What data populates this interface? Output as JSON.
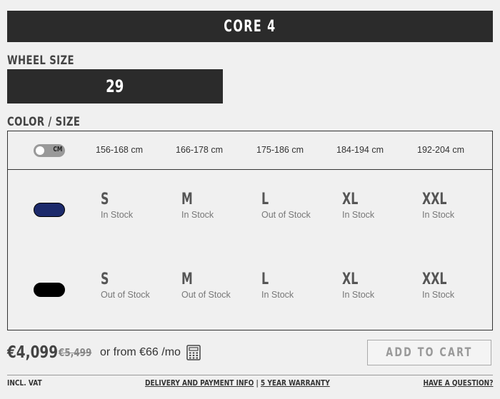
{
  "model": {
    "title": "CORE 4"
  },
  "wheel": {
    "label": "WHEEL SIZE",
    "value": "29"
  },
  "color_size": {
    "label": "COLOR / SIZE",
    "unit_toggle": "CM",
    "heights": [
      "156-168 cm",
      "166-178 cm",
      "175-186 cm",
      "184-194 cm",
      "192-204 cm"
    ],
    "rows": [
      {
        "color": "#1c2a6b",
        "sizes": [
          {
            "size": "S",
            "status": "In Stock"
          },
          {
            "size": "M",
            "status": "In Stock"
          },
          {
            "size": "L",
            "status": "Out of Stock"
          },
          {
            "size": "XL",
            "status": "In Stock"
          },
          {
            "size": "XXL",
            "status": "In Stock"
          }
        ]
      },
      {
        "color": "#000000",
        "sizes": [
          {
            "size": "S",
            "status": "Out of Stock"
          },
          {
            "size": "M",
            "status": "Out of Stock"
          },
          {
            "size": "L",
            "status": "In Stock"
          },
          {
            "size": "XL",
            "status": "In Stock"
          },
          {
            "size": "XXL",
            "status": "In Stock"
          }
        ]
      }
    ]
  },
  "price": {
    "current": "€4,099",
    "old": "€5,499",
    "finance": "or from €66 /mo"
  },
  "cart": {
    "label": "ADD TO CART"
  },
  "footer": {
    "vat": "INCL. VAT",
    "delivery": "DELIVERY AND PAYMENT INFO",
    "separator": "|",
    "warranty": "5 YEAR WARRANTY",
    "question": "HAVE A QUESTION?"
  }
}
